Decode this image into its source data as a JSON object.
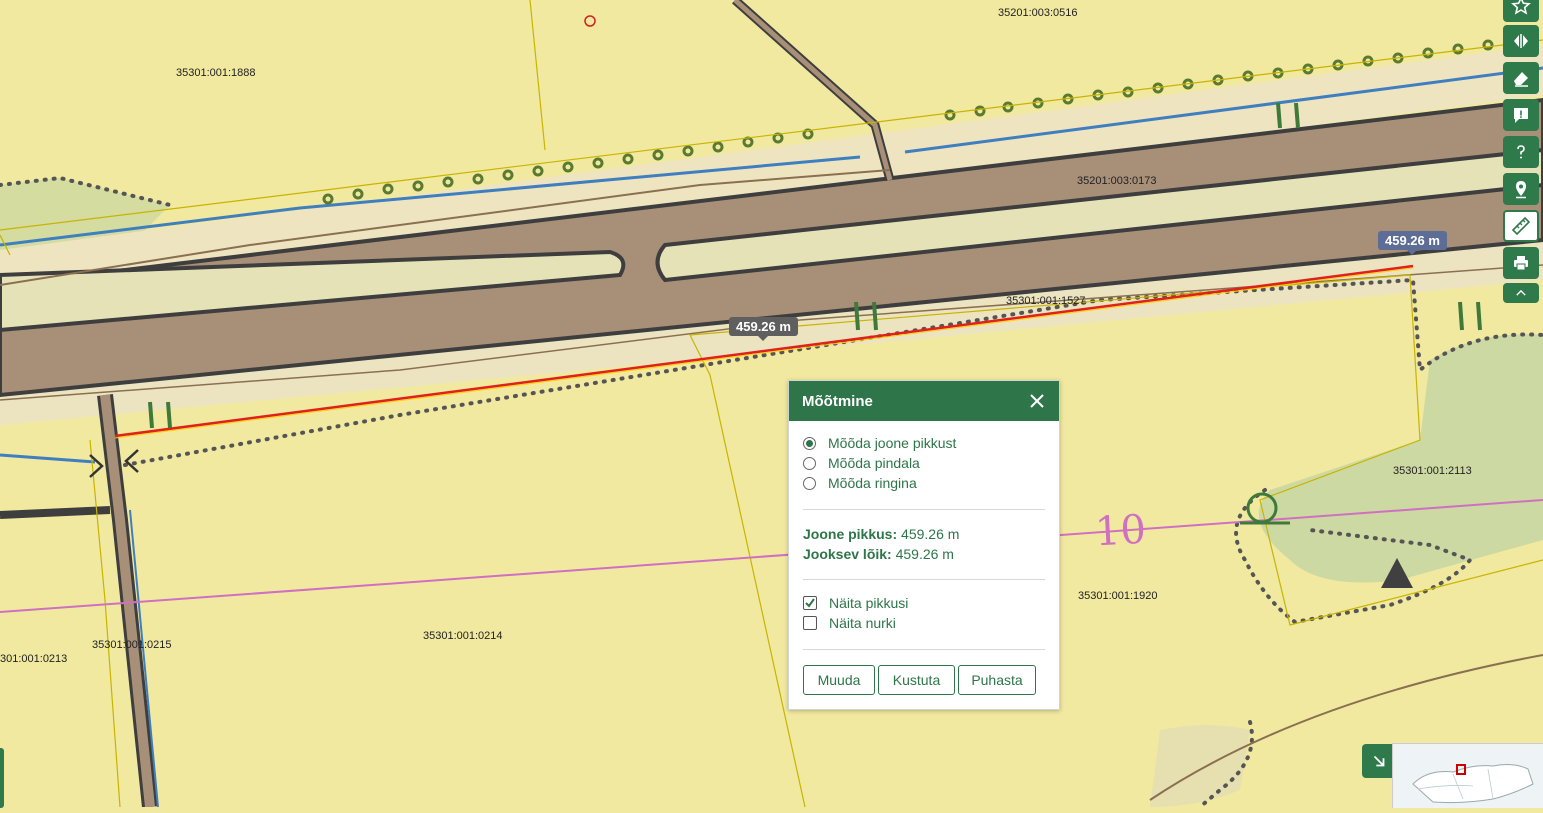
{
  "map": {
    "parcel_labels": [
      {
        "text": "35201:003:0516"
      },
      {
        "text": "35301:001:1888"
      },
      {
        "text": "35201:003:0173"
      },
      {
        "text": "35301:001:1527"
      },
      {
        "text": "35301:001:2113"
      },
      {
        "text": "35301:001:1920"
      },
      {
        "text": "35301:001:0215"
      },
      {
        "text": "35301:001:0214"
      },
      {
        "text": "301:001:0213"
      }
    ],
    "measure_tags": [
      "459.26 m",
      "459.26 m"
    ],
    "contour_number": "10",
    "colors": {
      "land": "#f1e9a0",
      "road": "#a88f78",
      "measure_line": "#e0201a",
      "water": "#3f7fbf",
      "contour": "#d070c0",
      "accent": "#2e7549"
    }
  },
  "toolbar": {
    "buttons": [
      {
        "name": "favorites-button",
        "icon": "star-icon"
      },
      {
        "name": "compare-button",
        "icon": "split-arrows-icon"
      },
      {
        "name": "eraser-button",
        "icon": "eraser-icon"
      },
      {
        "name": "feedback-button",
        "icon": "comment-alert-icon"
      },
      {
        "name": "help-button",
        "icon": "question-icon"
      },
      {
        "name": "location-button",
        "icon": "map-pin-icon"
      },
      {
        "name": "measure-button",
        "icon": "ruler-icon",
        "active": true
      },
      {
        "name": "print-button",
        "icon": "printer-icon"
      },
      {
        "name": "collapse-button",
        "icon": "chevron-up-icon"
      }
    ]
  },
  "panel": {
    "title": "Mõõtmine",
    "options": [
      {
        "label": "Mõõda joone pikkust",
        "checked": true
      },
      {
        "label": "Mõõda pindala",
        "checked": false
      },
      {
        "label": "Mõõda ringina",
        "checked": false
      }
    ],
    "results": {
      "line_length_label": "Joone pikkus:",
      "line_length_value": " 459.26 m",
      "segment_label": "Jooksev lõik:",
      "segment_value": " 459.26 m"
    },
    "checkboxes": [
      {
        "label": "Näita pikkusi",
        "checked": true
      },
      {
        "label": "Näita nurki",
        "checked": false
      }
    ],
    "buttons": {
      "edit": "Muuda",
      "delete": "Kustuta",
      "clear": "Puhasta"
    }
  }
}
